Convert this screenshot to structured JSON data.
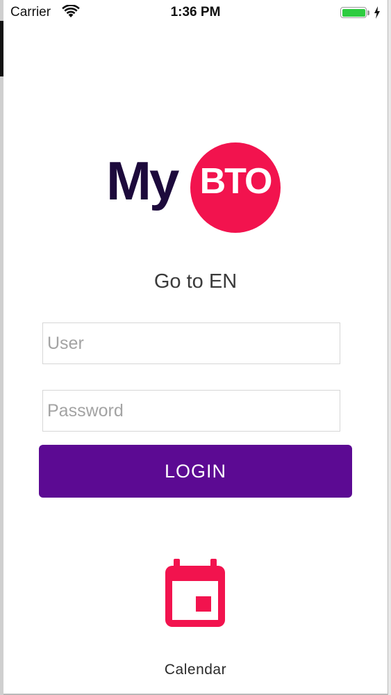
{
  "status_bar": {
    "carrier": "Carrier",
    "time": "1:36 PM",
    "wifi_icon": "wifi-icon",
    "battery_icon": "battery-icon",
    "charging_icon": "charging-bolt-icon"
  },
  "logo": {
    "text_left": "My",
    "text_circle": "BTO",
    "colors": {
      "text": "#1d0a3c",
      "circle": "#f2134e"
    }
  },
  "language_link": {
    "label": "Go to EN"
  },
  "form": {
    "user": {
      "value": "",
      "placeholder": "User"
    },
    "password": {
      "value": "",
      "placeholder": "Password"
    },
    "login_label": "LOGIN",
    "login_color": "#5c0a93"
  },
  "bottom": {
    "calendar_label": "Calendar",
    "calendar_icon": "calendar-icon",
    "calendar_color": "#f2134e"
  }
}
